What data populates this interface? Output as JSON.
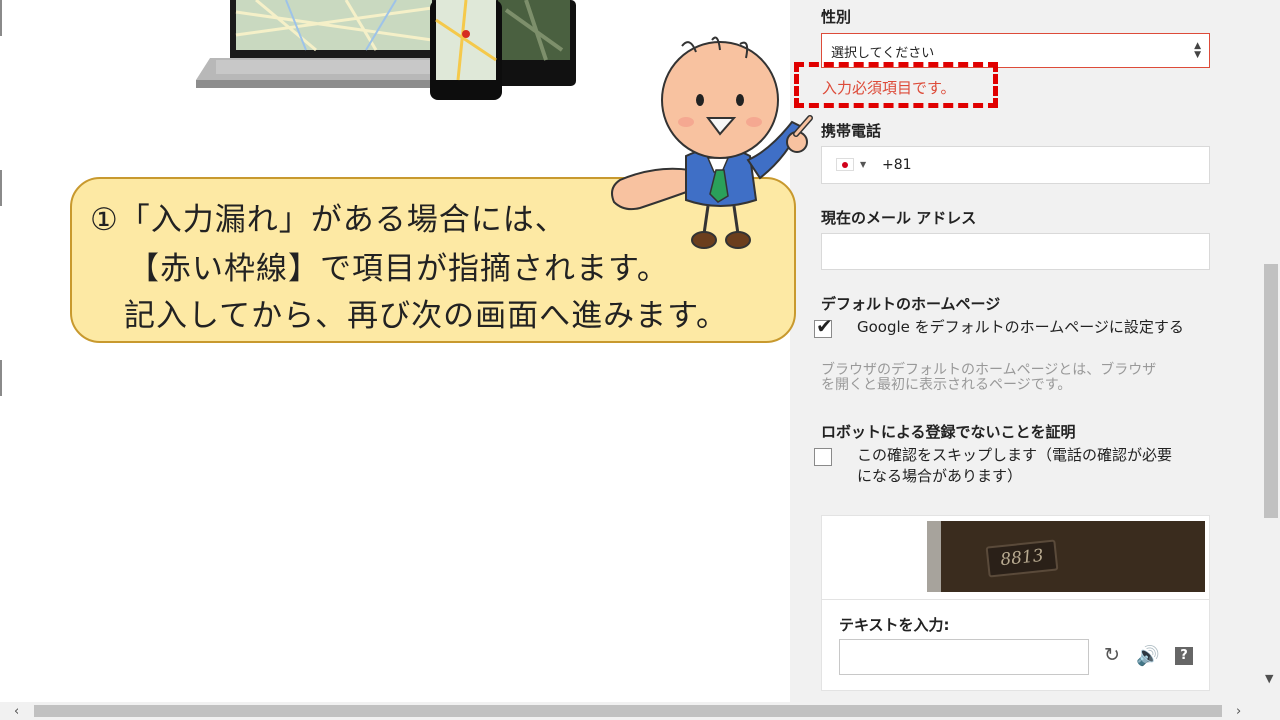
{
  "form": {
    "gender": {
      "label": "性別",
      "selected": "選択してください",
      "error": "入力必須項目です。"
    },
    "phone": {
      "label": "携帯電話",
      "country": "JP",
      "code": "+81"
    },
    "email": {
      "label": "現在のメール アドレス",
      "value": ""
    },
    "homepage": {
      "label": "デフォルトのホームページ",
      "checkbox_label": "Google をデフォルトのホームページに設定する",
      "checked": true,
      "hint_line1": "ブラウザのデフォルトのホームページとは、ブラウザ",
      "hint_line2": "を開くと最初に表示されるページです。"
    },
    "robot": {
      "label": "ロボットによる登録でないことを証明",
      "checkbox_line1": "この確認をスキップします（電話の確認が必要",
      "checkbox_line2": "になる場合があります）",
      "checked": false
    },
    "captcha": {
      "image_text": "8813",
      "input_label": "テキストを入力:",
      "value": ""
    }
  },
  "callout": {
    "line1": "①「入力漏れ」がある場合には、",
    "line2": "【赤い枠線】で項目が指摘されます。",
    "line3": "記入してから、再び次の画面へ進みます。"
  },
  "colors": {
    "error": "#dd4b39",
    "highlight": "#e00000",
    "bubble_fill": "#fde9a4",
    "bubble_border": "#c8992e"
  }
}
